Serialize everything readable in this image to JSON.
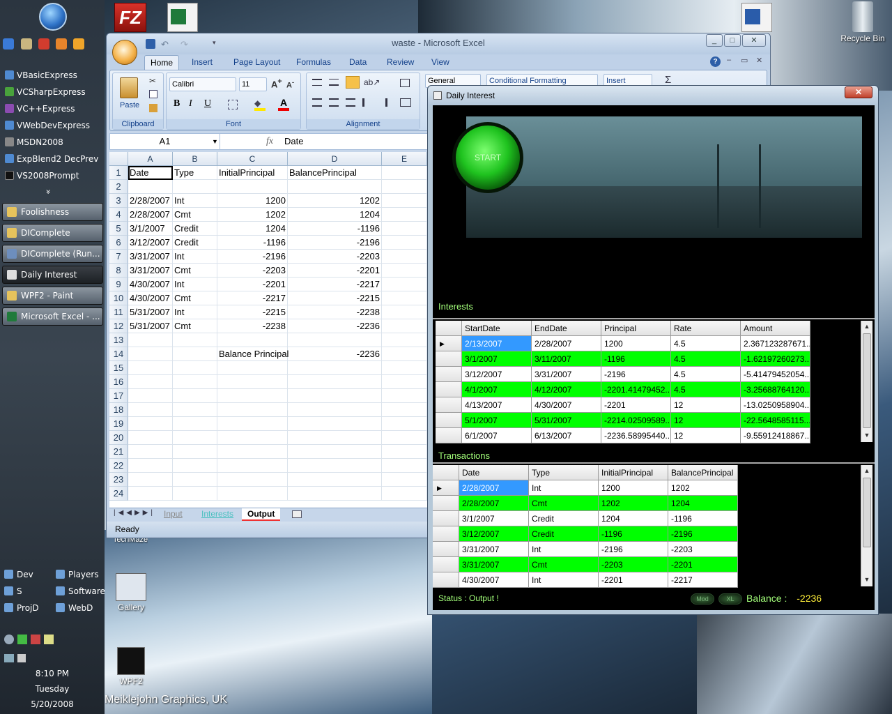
{
  "desktop": {
    "watermark": "Meiklejohn Graphics, UK",
    "partial_label": "TechMaze",
    "icons": {
      "recycle": "Recycle Bin",
      "gallery": "Gallery",
      "wpf2": "WPF2"
    }
  },
  "sidebar": {
    "quick_launch_icons": [
      "ie-icon",
      "photo-icon",
      "media-icon",
      "firefox-icon",
      "player-icon"
    ],
    "pinned": [
      "VBasicExpress",
      "VCSharpExpress",
      "VC++Express",
      "VWebDevExpress",
      "MSDN2008",
      "ExpBlend2 DecPrev",
      "VS2008Prompt"
    ],
    "more": "»",
    "taskbar": [
      "Foolishness",
      "DIComplete",
      "DIComplete (Run...",
      "Daily Interest",
      "WPF2 - Paint",
      "Microsoft Excel - ..."
    ],
    "active_task": "Daily Interest",
    "groups": [
      "Dev",
      "Players",
      "S",
      "Software",
      "ProjD",
      "WebD"
    ],
    "clock": {
      "time": "8:10 PM",
      "day": "Tuesday",
      "date": "5/20/2008"
    }
  },
  "excel": {
    "title": "waste - Microsoft Excel",
    "tabs": [
      "Home",
      "Insert",
      "Page Layout",
      "Formulas",
      "Data",
      "Review",
      "View"
    ],
    "active_tab": "Home",
    "clipboard": {
      "paste": "Paste",
      "label": "Clipboard"
    },
    "font": {
      "name": "Calibri",
      "size": "11",
      "label": "Font"
    },
    "alignment": {
      "label": "Alignment"
    },
    "number_format": "General",
    "cond_format": "Conditional Formatting",
    "insert": "Insert",
    "name_box": "A1",
    "fx": "fx",
    "formula": "Date",
    "columns": [
      "A",
      "B",
      "C",
      "D",
      "E"
    ],
    "rows": [
      {
        "n": "1",
        "a": "Date",
        "b": "Type",
        "c": "InitialPrincipal",
        "d": "BalancePrincipal"
      },
      {
        "n": "2",
        "a": "",
        "b": "",
        "c": "",
        "d": ""
      },
      {
        "n": "3",
        "a": "2/28/2007",
        "b": "Int",
        "c": "1200",
        "d": "1202"
      },
      {
        "n": "4",
        "a": "2/28/2007",
        "b": "Cmt",
        "c": "1202",
        "d": "1204"
      },
      {
        "n": "5",
        "a": "3/1/2007",
        "b": "Credit",
        "c": "1204",
        "d": "-1196"
      },
      {
        "n": "6",
        "a": "3/12/2007",
        "b": "Credit",
        "c": "-1196",
        "d": "-2196"
      },
      {
        "n": "7",
        "a": "3/31/2007",
        "b": "Int",
        "c": "-2196",
        "d": "-2203"
      },
      {
        "n": "8",
        "a": "3/31/2007",
        "b": "Cmt",
        "c": "-2203",
        "d": "-2201"
      },
      {
        "n": "9",
        "a": "4/30/2007",
        "b": "Int",
        "c": "-2201",
        "d": "-2217"
      },
      {
        "n": "10",
        "a": "4/30/2007",
        "b": "Cmt",
        "c": "-2217",
        "d": "-2215"
      },
      {
        "n": "11",
        "a": "5/31/2007",
        "b": "Int",
        "c": "-2215",
        "d": "-2238"
      },
      {
        "n": "12",
        "a": "5/31/2007",
        "b": "Cmt",
        "c": "-2238",
        "d": "-2236"
      },
      {
        "n": "13",
        "a": "",
        "b": "",
        "c": "",
        "d": ""
      },
      {
        "n": "14",
        "a": "",
        "b": "",
        "c": "Balance Principal",
        "d": "-2236"
      },
      {
        "n": "15"
      },
      {
        "n": "16"
      },
      {
        "n": "17"
      },
      {
        "n": "18"
      },
      {
        "n": "19"
      },
      {
        "n": "20"
      },
      {
        "n": "21"
      },
      {
        "n": "22"
      },
      {
        "n": "23"
      },
      {
        "n": "24"
      }
    ],
    "sheets": [
      "Input",
      "Interests",
      "Output"
    ],
    "active_sheet": "Output",
    "status": "Ready"
  },
  "daily": {
    "title": "Daily Interest",
    "close": "✕",
    "start": "START",
    "interests_label": "Interests",
    "interest_cols": [
      "StartDate",
      "EndDate",
      "Principal",
      "Rate",
      "Amount"
    ],
    "interest_rows": [
      [
        "2/13/2007",
        "2/28/2007",
        "1200",
        "4.5",
        "2.367123287671..."
      ],
      [
        "3/1/2007",
        "3/11/2007",
        "-1196",
        "4.5",
        "-1.62197260273..."
      ],
      [
        "3/12/2007",
        "3/31/2007",
        "-2196",
        "4.5",
        "-5.41479452054..."
      ],
      [
        "4/1/2007",
        "4/12/2007",
        "-2201.41479452...",
        "4.5",
        "-3.25688764120..."
      ],
      [
        "4/13/2007",
        "4/30/2007",
        "-2201",
        "12",
        "-13.0250958904..."
      ],
      [
        "5/1/2007",
        "5/31/2007",
        "-2214.02509589...",
        "12",
        "-22.5648585115..."
      ],
      [
        "6/1/2007",
        "6/13/2007",
        "-2236.58995440...",
        "12",
        "-9.55912418867..."
      ]
    ],
    "transactions_label": "Transactions",
    "trans_cols": [
      "Date",
      "Type",
      "InitialPrincipal",
      "BalancePrincipal"
    ],
    "trans_rows": [
      [
        "2/28/2007",
        "Int",
        "1200",
        "1202"
      ],
      [
        "2/28/2007",
        "Cmt",
        "1202",
        "1204"
      ],
      [
        "3/1/2007",
        "Credit",
        "1204",
        "-1196"
      ],
      [
        "3/12/2007",
        "Credit",
        "-1196",
        "-2196"
      ],
      [
        "3/31/2007",
        "Int",
        "-2196",
        "-2203"
      ],
      [
        "3/31/2007",
        "Cmt",
        "-2203",
        "-2201"
      ],
      [
        "4/30/2007",
        "Int",
        "-2201",
        "-2217"
      ]
    ],
    "status": "Status :  Output !",
    "pill1": "Mod",
    "pill2": "XL",
    "balance_label": "Balance :",
    "balance_value": "-2236",
    "colors": {
      "row_alt": "#00ff00",
      "accent": "#a3ff7a",
      "selected": "#3399ff"
    }
  }
}
